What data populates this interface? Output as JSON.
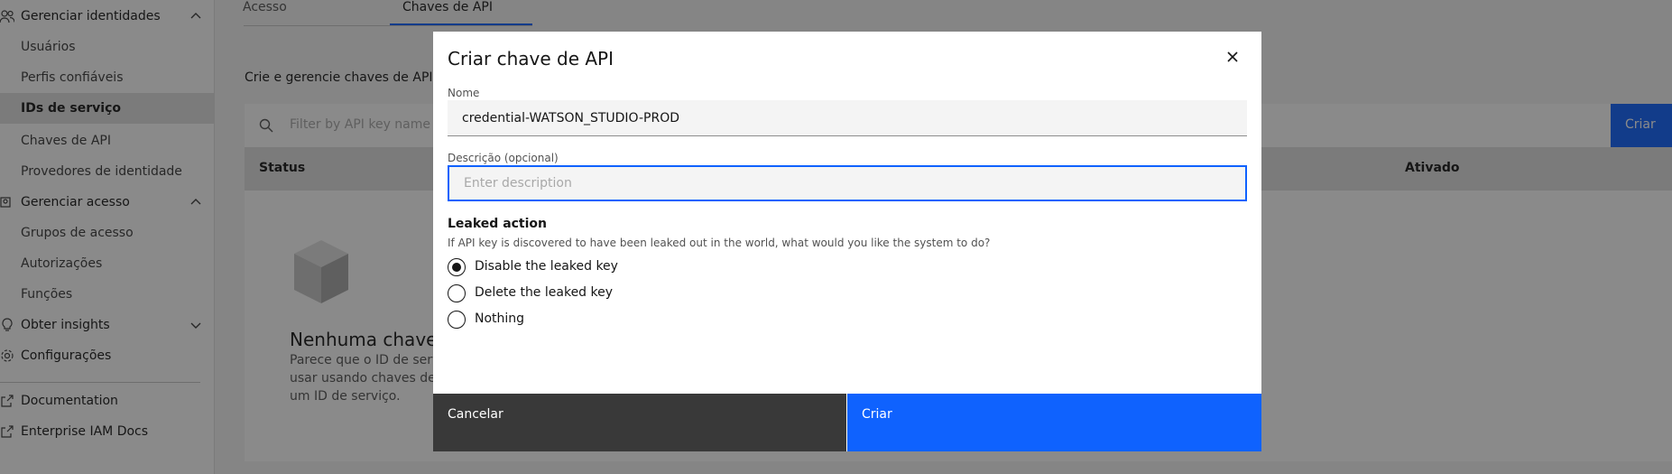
{
  "sidebar": {
    "items": [
      {
        "label": "Gerenciar identidades",
        "type": "section",
        "icon": "users-icon",
        "expanded": true
      },
      {
        "label": "Usuários"
      },
      {
        "label": "Perfis confiáveis"
      },
      {
        "label": "IDs de serviço",
        "active": true
      },
      {
        "label": "Chaves de API"
      },
      {
        "label": "Provedores de identidade"
      },
      {
        "label": "Gerenciar acesso",
        "type": "section",
        "icon": "access-icon",
        "expanded": true
      },
      {
        "label": "Grupos de acesso"
      },
      {
        "label": "Autorizações"
      },
      {
        "label": "Funções"
      },
      {
        "label": "Obter insights",
        "type": "section",
        "icon": "lightbulb-icon",
        "expanded": false
      },
      {
        "label": "Configurações",
        "icon": "gear-icon"
      },
      {
        "label": "Documentation",
        "icon": "launch-icon"
      },
      {
        "label": "Enterprise IAM Docs",
        "icon": "launch-icon"
      }
    ]
  },
  "main": {
    "tabs": [
      {
        "label": "Acesso"
      },
      {
        "label": "Chaves de API",
        "active": true
      }
    ],
    "description": "Crie e gerencie chaves de API pa",
    "search_placeholder": "Filter by API key name or",
    "create_label": "Criar",
    "create_icon": "+",
    "columns": [
      "Status",
      "Ativado"
    ],
    "empty_title": "Nenhuma chave d",
    "empty_lines": [
      "Parece que o ID de serviç",
      "usar usando chaves de A",
      "um ID de serviço."
    ]
  },
  "modal": {
    "title": "Criar chave de API",
    "close_icon": "×",
    "name_label": "Nome",
    "name_value": "credential-WATSON_STUDIO-PROD",
    "desc_label": "Descrição (opcional)",
    "desc_placeholder": "Enter description",
    "leaked_title": "Leaked action",
    "leaked_help": "If API key is discovered to have been leaked out in the world, what would you like the system to do?",
    "options": [
      {
        "label": "Disable the leaked key",
        "checked": true
      },
      {
        "label": "Delete the leaked key",
        "checked": false
      },
      {
        "label": "Nothing",
        "checked": false
      }
    ],
    "cancel_label": "Cancelar",
    "create_label": "Criar"
  },
  "colors": {
    "primary": "#0f62fe",
    "secondary_button": "#393939",
    "overlay": "rgba(22,22,22,0.5)"
  }
}
